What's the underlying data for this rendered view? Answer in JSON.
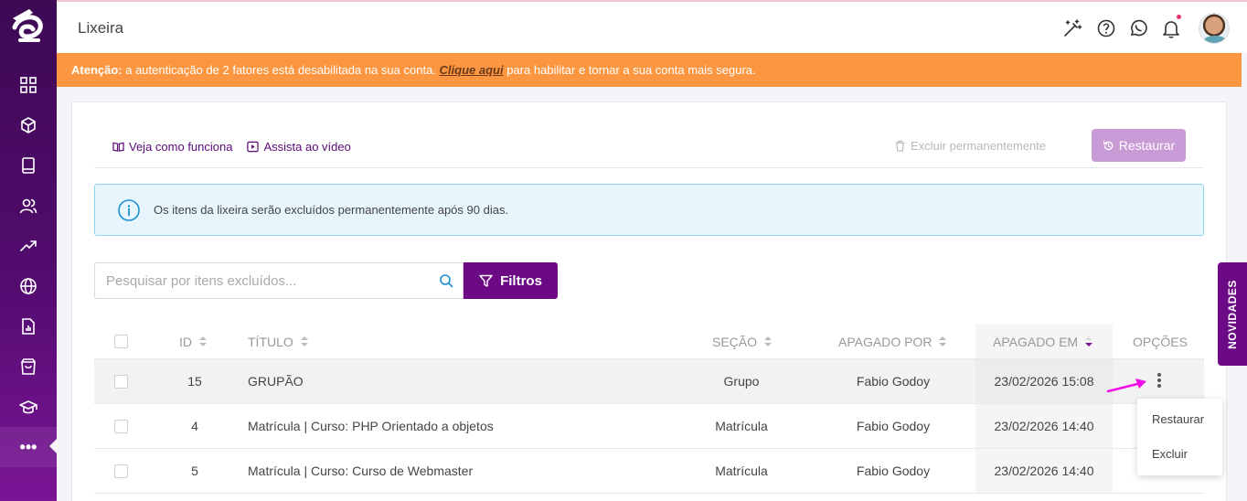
{
  "app": {
    "page_title": "Lixeira"
  },
  "sidebar": {
    "logo": "brand-logo",
    "items": [
      {
        "icon": "dashboard-icon"
      },
      {
        "icon": "cube-icon"
      },
      {
        "icon": "book-icon"
      },
      {
        "icon": "users-icon"
      },
      {
        "icon": "trending-up-icon"
      },
      {
        "icon": "globe-icon"
      },
      {
        "icon": "report-icon"
      },
      {
        "icon": "shopping-bag-icon"
      },
      {
        "icon": "graduation-cap-icon"
      },
      {
        "icon": "more-icon",
        "label": "•••"
      }
    ]
  },
  "topbar": {
    "icons": [
      "magic-wand-icon",
      "help-icon",
      "whatsapp-icon",
      "bell-icon"
    ]
  },
  "alert": {
    "prefix": "Atenção:",
    "text_before": " a autenticação de 2 fatores está desabilitada na sua conta. ",
    "link": "Clique aqui",
    "text_after": " para habilitar e tornar a sua conta mais segura."
  },
  "toolbar": {
    "how_it_works": "Veja como funciona",
    "watch_video": "Assista ao vídeo",
    "delete_permanently": "Excluir permanentemente",
    "restore": "Restaurar"
  },
  "info": {
    "text": "Os itens da lixeira serão excluídos permanentemente após 90 dias."
  },
  "search": {
    "placeholder": "Pesquisar por itens excluídos...",
    "filters_label": "Filtros"
  },
  "table": {
    "columns": {
      "id": "ID",
      "title": "TÍTULO",
      "section": "SEÇÃO",
      "deleted_by": "APAGADO POR",
      "deleted_at": "APAGADO EM",
      "options": "OPÇÕES"
    },
    "rows": [
      {
        "id": "15",
        "title": "GRUPÃO",
        "section": "Grupo",
        "deleted_by": "Fabio Godoy",
        "deleted_at": "23/02/2026 15:08"
      },
      {
        "id": "4",
        "title": "Matrícula | Curso: PHP Orientado a objetos",
        "section": "Matrícula",
        "deleted_by": "Fabio Godoy",
        "deleted_at": "23/02/2026 14:40"
      },
      {
        "id": "5",
        "title": "Matrícula | Curso: Curso de Webmaster",
        "section": "Matrícula",
        "deleted_by": "Fabio Godoy",
        "deleted_at": "23/02/2026 14:40"
      }
    ]
  },
  "row_menu": {
    "restore": "Restaurar",
    "delete": "Excluir"
  },
  "side_tab": {
    "label": "NOVIDADES"
  },
  "colors": {
    "brand": "#6c0a86",
    "alert": "#fd9640",
    "info_bg": "#e6f6fc",
    "restore_btn": "#c99bd6",
    "arrow": "#f20fe6"
  }
}
